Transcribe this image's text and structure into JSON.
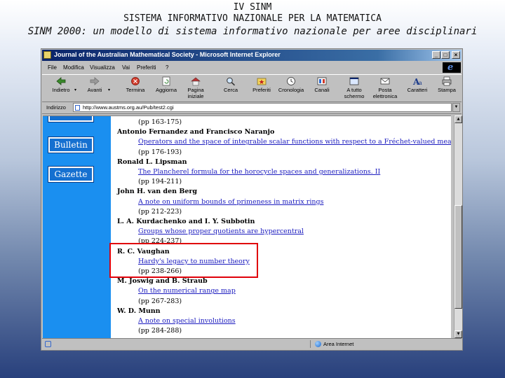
{
  "slide": {
    "title_line1": "IV SINM",
    "title_line2": "SISTEMA INFORMATIVO NAZIONALE PER LA MATEMATICA",
    "title_line3": "SINM 2000: un modello di sistema informativo nazionale per aree disciplinari"
  },
  "window": {
    "title": "Journal of the Australian Mathematical Society - Microsoft Internet Explorer",
    "controls": {
      "minimize": "_",
      "maximize": "□",
      "close": "×"
    },
    "logo_letter": "e"
  },
  "menu": [
    "File",
    "Modifica",
    "Visualizza",
    "Vai",
    "Preferiti",
    "?"
  ],
  "toolbar": [
    {
      "label": "Indietro",
      "icon": "back-arrow-icon"
    },
    {
      "label": "Avanti",
      "icon": "forward-arrow-icon"
    },
    {
      "label": "Termina",
      "icon": "stop-icon"
    },
    {
      "label": "Aggiorna",
      "icon": "refresh-icon"
    },
    {
      "label": "Pagina iniziale",
      "icon": "home-icon"
    },
    {
      "label": "Cerca",
      "icon": "search-icon"
    },
    {
      "label": "Preferiti",
      "icon": "favorites-icon"
    },
    {
      "label": "Cronologia",
      "icon": "history-icon"
    },
    {
      "label": "Canali",
      "icon": "channels-icon"
    },
    {
      "label": "A tutto schermo",
      "icon": "fullscreen-icon"
    },
    {
      "label": "Posta elettronica",
      "icon": "mail-icon"
    },
    {
      "label": "Caratteri",
      "icon": "font-icon"
    },
    {
      "label": "Stampa",
      "icon": "print-icon"
    }
  ],
  "address": {
    "label": "Indirizzo",
    "url": "http://www.austms.org.au/Pub/test2.cgi"
  },
  "nav": {
    "bulletin": "Bulletin",
    "gazette": "Gazette"
  },
  "articles": {
    "first_pages": "(pp 163-175)",
    "items": [
      {
        "authors": "Antonio Fernandez and Francisco Naranjo",
        "title": "Operators and the space of integrable scalar functions with respect to a Fréchet-valued measure",
        "pages": "(pp 176-193)"
      },
      {
        "authors": "Ronald L. Lipsman",
        "title": "The Plancherel formula for the horocycle spaces and generalizations. II",
        "pages": "(pp 194-211)"
      },
      {
        "authors": "John H. van den Berg",
        "title": "A note on uniform bounds of primeness in matrix rings",
        "pages": "(pp 212-223)"
      },
      {
        "authors": "L. A. Kurdachenko and I. Y. Subbotin",
        "title": "Groups whose proper quotients are hypercentral",
        "pages": "(pp 224-237)"
      },
      {
        "authors": "R. C. Vaughan",
        "title": "Hardy's legacy to number theory",
        "pages": "(pp 238-266)"
      },
      {
        "authors": "M. Joswig and B. Straub",
        "title": "On the numerical range map",
        "pages": "(pp 267-283)"
      },
      {
        "authors": "W. D. Munn",
        "title": "A note on special involutions",
        "pages": "(pp 284-288)"
      }
    ]
  },
  "scroll": {
    "up": "▲",
    "down": "▼"
  },
  "status": {
    "zone": "Area Internet"
  }
}
